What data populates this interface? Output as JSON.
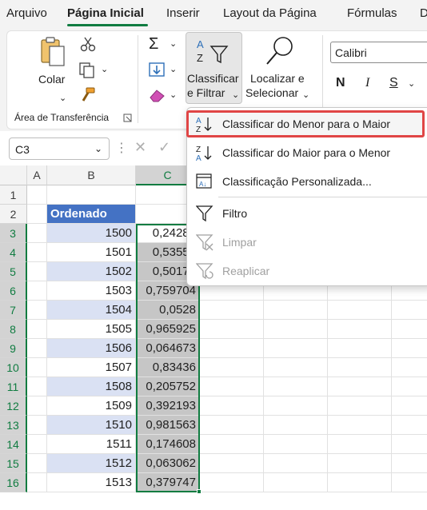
{
  "tabs": [
    "Arquivo",
    "Página Inicial",
    "Inserir",
    "Layout da Página",
    "Fórmulas",
    "D"
  ],
  "active_tab": "Página Inicial",
  "ribbon": {
    "paste_label": "Colar",
    "clipboard_group_label": "Área de Transferência",
    "sort_filter_label_line1": "Classificar",
    "sort_filter_label_line2": "e Filtrar",
    "find_select_label_line1": "Localizar e",
    "find_select_label_line2": "Selecionar",
    "font_name": "Calibri",
    "bold_label": "N",
    "italic_label": "I",
    "underline_label": "S"
  },
  "formula_bar": {
    "name_box": "C3"
  },
  "grid": {
    "columns": [
      "A",
      "B",
      "C"
    ],
    "rows": [
      "1",
      "2",
      "3",
      "4",
      "5",
      "6",
      "7",
      "8",
      "9",
      "10",
      "11",
      "12",
      "13",
      "14",
      "15",
      "16"
    ],
    "header_label": "Ordenado",
    "b_values": [
      "1500",
      "1501",
      "1502",
      "1503",
      "1504",
      "1505",
      "1506",
      "1507",
      "1508",
      "1509",
      "1510",
      "1511",
      "1512",
      "1513"
    ],
    "c_values": [
      "0,24283",
      "0,53551",
      "0,50173",
      "0,759704",
      "0,0528",
      "0,965925",
      "0,064673",
      "0,83436",
      "0,205752",
      "0,392193",
      "0,981563",
      "0,174608",
      "0,063062",
      "0,379747"
    ]
  },
  "menu": {
    "items": [
      {
        "label": "Classificar do Menor para o Maior",
        "icon": "sort-ascending-icon",
        "enabled": true,
        "highlighted": true
      },
      {
        "label": "Classificar do Maior para o Menor",
        "icon": "sort-descending-icon",
        "enabled": true
      },
      {
        "label": "Classificação Personalizada...",
        "icon": "custom-sort-icon",
        "enabled": true
      },
      {
        "label": "Filtro",
        "icon": "filter-icon",
        "enabled": true
      },
      {
        "label": "Limpar",
        "icon": "clear-filter-icon",
        "enabled": false
      },
      {
        "label": "Reaplicar",
        "icon": "reapply-icon",
        "enabled": false
      }
    ]
  },
  "colors": {
    "accent": "#107c41",
    "header_fill": "#4472c4",
    "band_fill": "#dae1f3",
    "highlight_border": "#e04545"
  }
}
